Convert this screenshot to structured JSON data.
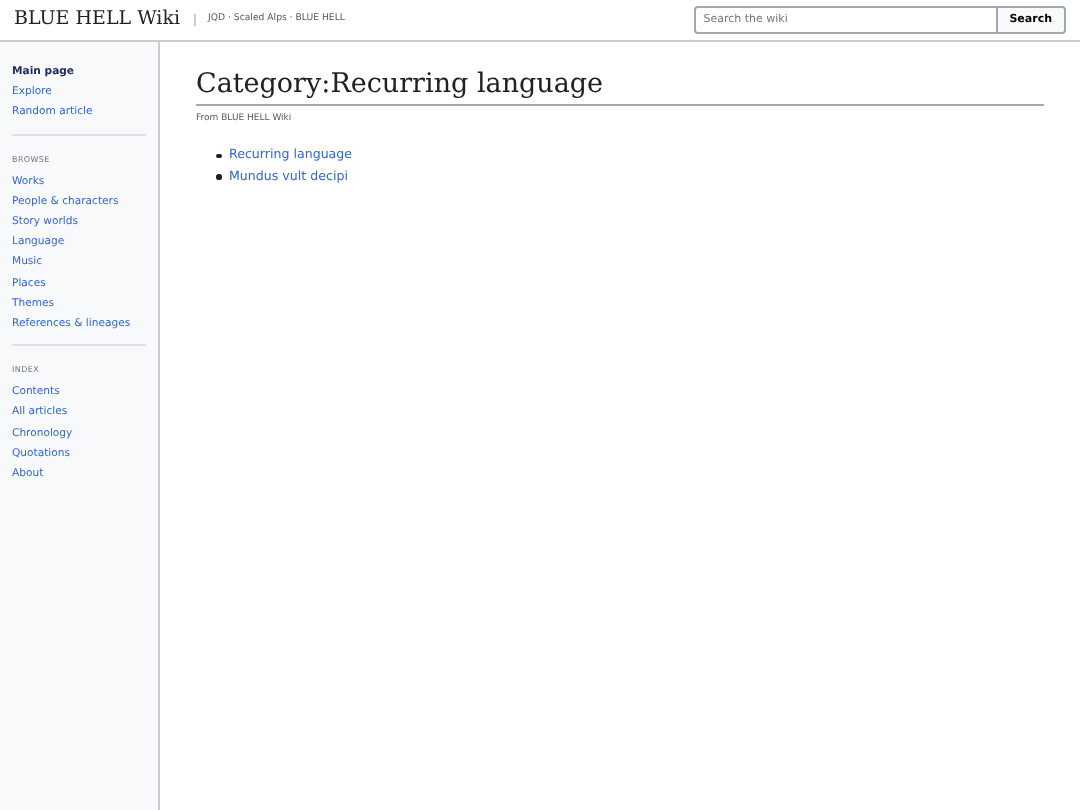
{
  "header": {
    "site_title": "BLUE HELL Wiki",
    "tagline": "JQD · Scaled Alps · BLUE HELL",
    "search": {
      "placeholder": "Search the wiki",
      "button": "Search"
    }
  },
  "sidebar": {
    "sections": [
      {
        "items": [
          {
            "label": "Main page",
            "selected": true
          },
          {
            "label": "Explore",
            "selected": false
          },
          {
            "label": "Random article",
            "selected": false
          }
        ]
      },
      {
        "heading": "BROWSE",
        "items": [
          {
            "label": "Works",
            "selected": false
          },
          {
            "label": "People & characters",
            "selected": false
          },
          {
            "label": "Story worlds",
            "selected": false
          },
          {
            "label": "Language",
            "selected": false
          },
          {
            "label": "Music",
            "selected": false
          },
          {
            "label": "Places",
            "selected": false
          },
          {
            "label": "Themes",
            "selected": false
          },
          {
            "label": "References & lineages",
            "selected": false
          }
        ]
      },
      {
        "heading": "INDEX",
        "items": [
          {
            "label": "Contents",
            "selected": false
          },
          {
            "label": "All articles",
            "selected": false
          },
          {
            "label": "Chronology",
            "selected": false
          },
          {
            "label": "Quotations",
            "selected": false
          },
          {
            "label": "About",
            "selected": false
          }
        ]
      }
    ]
  },
  "content": {
    "title": "Category:Recurring language",
    "subtitle": "From BLUE HELL Wiki",
    "pages": [
      "Recurring language",
      "Mundus vult decipi"
    ]
  }
}
